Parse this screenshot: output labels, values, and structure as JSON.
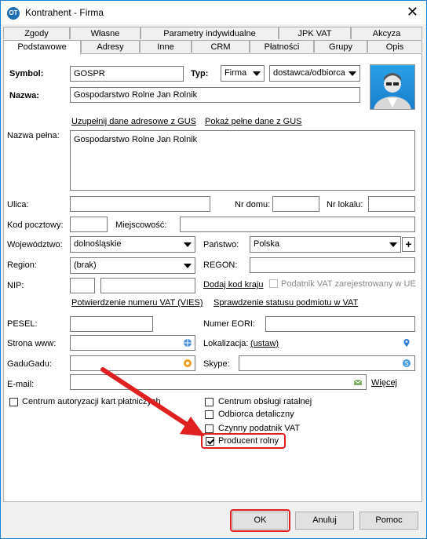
{
  "window": {
    "title": "Kontrahent - Firma",
    "icon_text": "OT",
    "close": "✕"
  },
  "tabs_back": [
    "Zgody",
    "Własne",
    "Parametry indywidualne",
    "JPK VAT",
    "Akcyza"
  ],
  "tabs_front": [
    "Podstawowe",
    "Adresy",
    "Inne",
    "CRM",
    "Płatności",
    "Grupy",
    "Opis"
  ],
  "form": {
    "symbol_label": "Symbol:",
    "symbol_value": "GOSPR",
    "typ_label": "Typ:",
    "typ_value": "Firma",
    "relation_value": "dostawca/odbiorca",
    "nazwa_label": "Nazwa:",
    "nazwa_value": "Gospodarstwo Rolne Jan Rolnik",
    "gus_fill_link": "Uzupełnij dane adresowe z GUS",
    "gus_show_link": "Pokaż pełne dane z GUS",
    "nazwa_pelna_label": "Nazwa pełna:",
    "nazwa_pelna_value": "Gospodarstwo Rolne Jan Rolnik",
    "ulica_label": "Ulica:",
    "nr_domu_label": "Nr domu:",
    "nr_lokalu_label": "Nr lokalu:",
    "kod_label": "Kod pocztowy:",
    "miejscowosc_label": "Miejscowość:",
    "woj_label": "Województwo:",
    "woj_value": "dolnośląskie",
    "panstwo_label": "Państwo:",
    "panstwo_value": "Polska",
    "region_label": "Region:",
    "region_value": "(brak)",
    "regon_label": "REGON:",
    "nip_label": "NIP:",
    "dodaj_kod_link": "Dodaj kod kraju",
    "vat_ue_label": "Podatnik VAT zarejestrowany w UE",
    "vies_link": "Potwierdzenie numeru VAT (VIES)",
    "status_link": "Sprawdzenie statusu podmiotu w VAT",
    "pesel_label": "PESEL:",
    "eori_label": "Numer EORI:",
    "www_label": "Strona www:",
    "lokalizacja_label": "Lokalizacja:",
    "ustaw_link": "(ustaw)",
    "gadu_label": "GaduGadu:",
    "skype_label": "Skype:",
    "email_label": "E-mail:",
    "wiecej_link": "Więcej"
  },
  "checkboxes": {
    "cakp": "Centrum autoryzacji kart płatniczych",
    "centrum_ratalne": "Centrum obsługi ratalnej",
    "odbiorca_detaliczny": "Odbiorca detaliczny",
    "czynny_vat": "Czynny podatnik VAT",
    "producent_rolny": "Producent rolny"
  },
  "buttons": {
    "ok": "OK",
    "anuluj": "Anuluj",
    "pomoc": "Pomoc"
  },
  "colors": {
    "annotation_red": "#e02020",
    "link_accent": "#1883d7"
  }
}
